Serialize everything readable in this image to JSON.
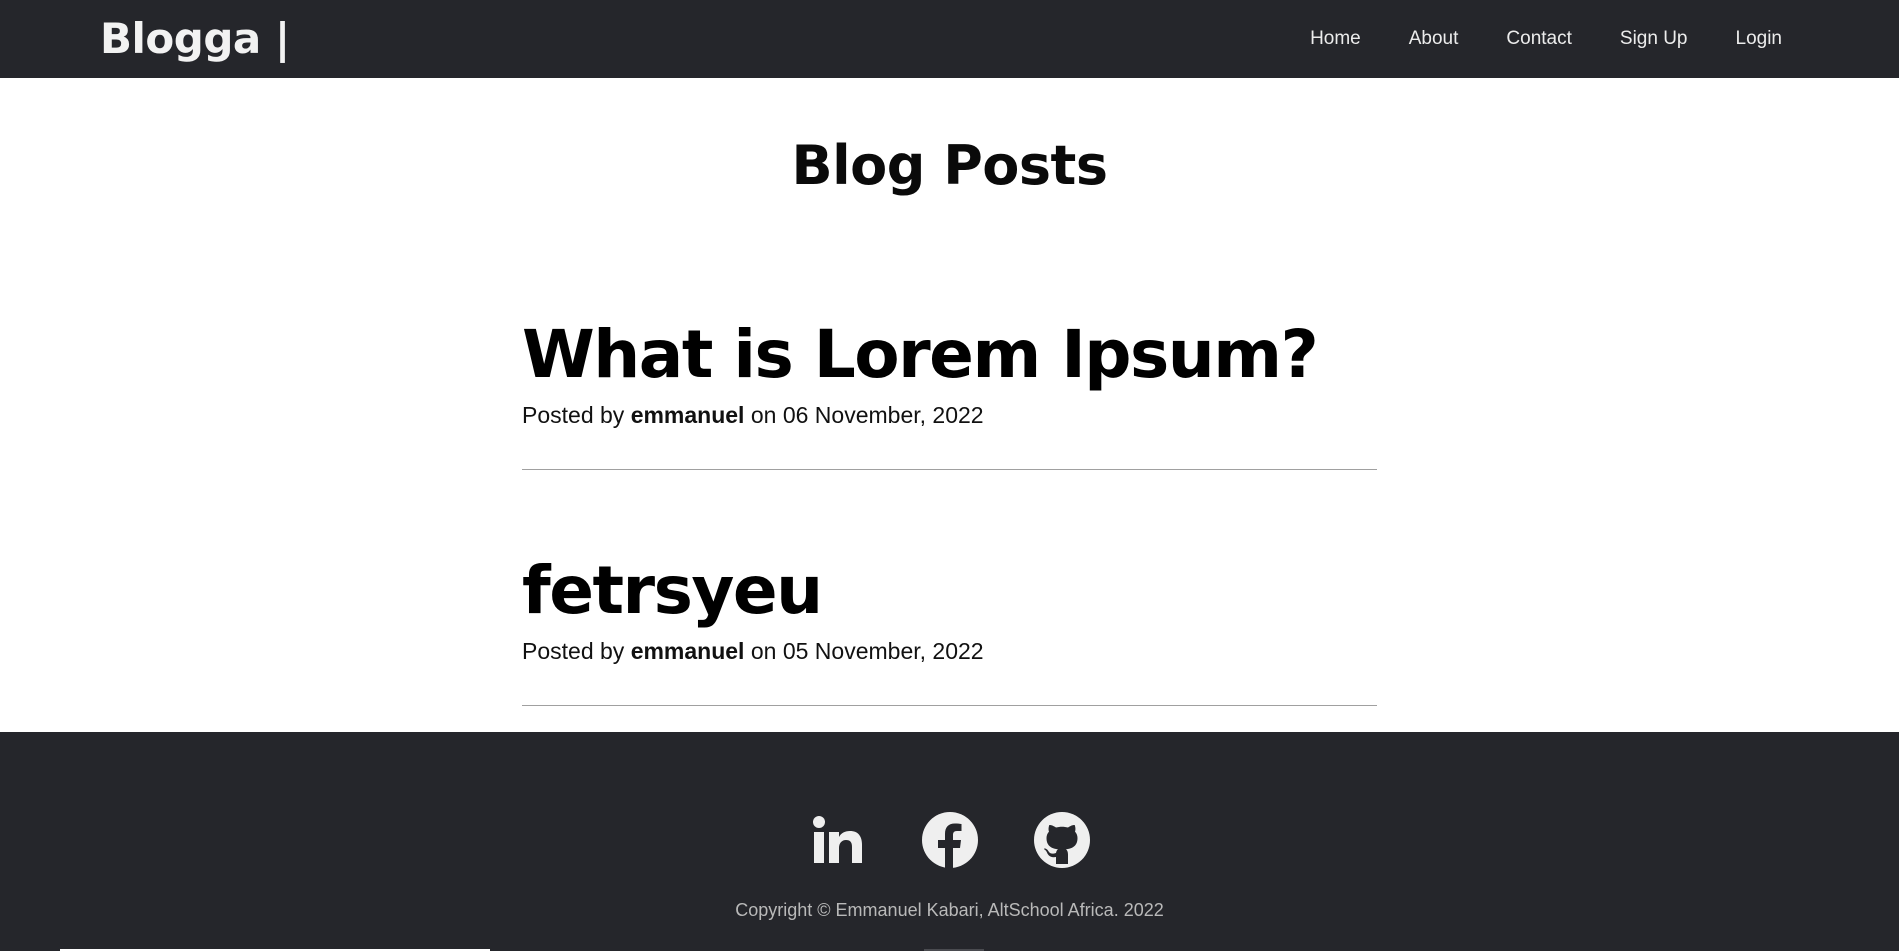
{
  "navbar": {
    "brand": "Blogga |",
    "links": [
      {
        "label": "Home"
      },
      {
        "label": "About"
      },
      {
        "label": "Contact"
      },
      {
        "label": "Sign Up"
      },
      {
        "label": "Login"
      }
    ]
  },
  "main": {
    "title": "Blog Posts",
    "posts": [
      {
        "title": "What is Lorem Ipsum?",
        "posted_by_prefix": "Posted by",
        "author": "emmanuel",
        "date_prefix": "on",
        "date": "06 November, 2022"
      },
      {
        "title": "fetrsyeu",
        "posted_by_prefix": "Posted by",
        "author": "emmanuel",
        "date_prefix": "on",
        "date": "05 November, 2022"
      }
    ]
  },
  "footer": {
    "social": [
      {
        "icon": "linkedin-icon"
      },
      {
        "icon": "facebook-icon"
      },
      {
        "icon": "github-icon"
      }
    ],
    "copyright": "Copyright © Emmanuel Kabari, AltSchool Africa. 2022"
  },
  "colors": {
    "header_bg": "#25262b",
    "footer_bg": "#25262b",
    "page_bg": "#ffffff",
    "nav_text": "#ececec",
    "copyright_text": "#b9b9b9",
    "divider": "#a0a0a0"
  }
}
